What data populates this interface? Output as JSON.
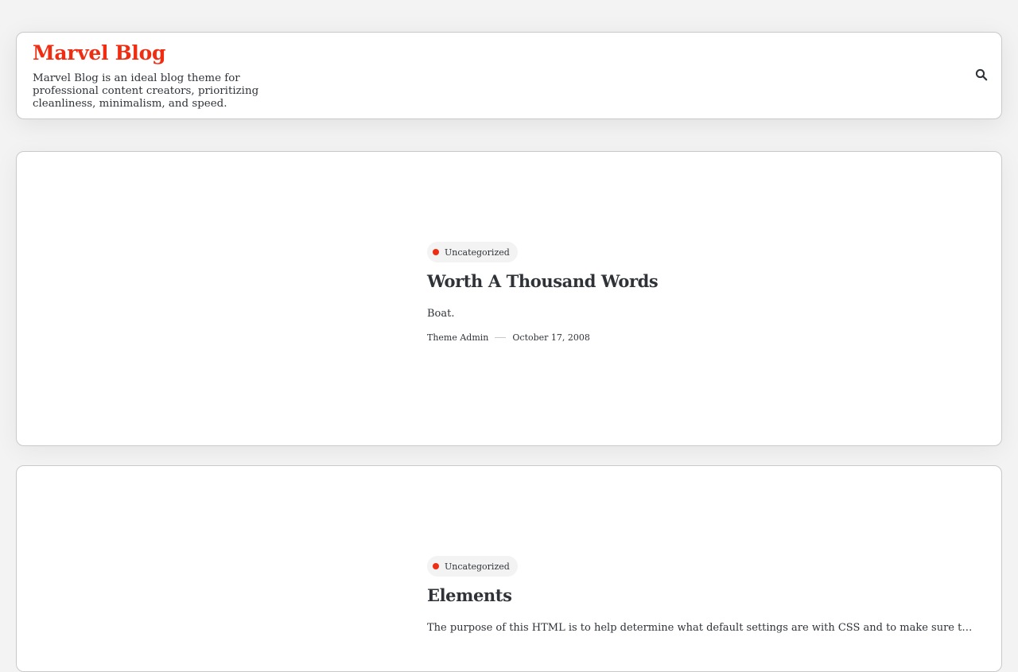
{
  "site": {
    "title": "Marvel Blog",
    "description": "Marvel Blog is an ideal blog theme for professional content creators, prioritizing cleanliness, minimalism, and speed."
  },
  "colors": {
    "accent": "#ee2d12",
    "text": "#2f3338",
    "background": "#f3f3f3",
    "card": "#ffffff",
    "border": "#c9c9c9"
  },
  "icons": {
    "search": "search-icon"
  },
  "posts": [
    {
      "category": "Uncategorized",
      "title": "Worth A Thousand Words",
      "excerpt": "Boat.",
      "author": "Theme Admin",
      "date": "October 17, 2008"
    },
    {
      "category": "Uncategorized",
      "title": "Elements",
      "excerpt": "The purpose of this HTML is to help determine what default settings are with CSS and to make sure that all possible HTML Elements are included in this post so that the theme is tested.",
      "author": "",
      "date": ""
    }
  ]
}
